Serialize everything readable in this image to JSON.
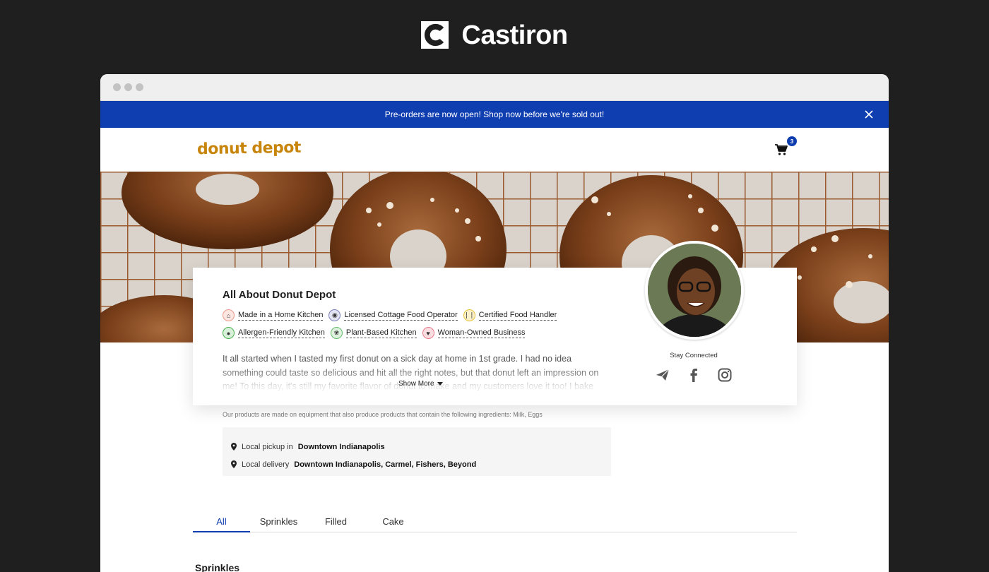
{
  "brand": {
    "name": "Castiron"
  },
  "announcement": {
    "text": "Pre-orders are now open! Shop now before we're sold out!"
  },
  "site": {
    "logo_text": "donut depot",
    "cart_count": "3"
  },
  "about": {
    "title": "All About Donut Depot",
    "badges_row1": [
      {
        "label": "Made in a Home Kitchen",
        "icon": "home-icon",
        "color": "#e89a8a"
      },
      {
        "label": "Licensed Cottage Food Operator",
        "icon": "shield-icon",
        "color": "#7a7fb8"
      },
      {
        "label": "Certified Food Handler",
        "icon": "utensils-icon",
        "color": "#e8c23a"
      }
    ],
    "badges_row2": [
      {
        "label": "Allergen-Friendly Kitchen",
        "icon": "allergen-icon",
        "color": "#4caf50"
      },
      {
        "label": "Plant-Based Kitchen",
        "icon": "sprout-icon",
        "color": "#66bb6a"
      },
      {
        "label": "Woman-Owned Business",
        "icon": "heart-icon",
        "color": "#e57c8c"
      }
    ],
    "story": "It all started when I tasted my first donut on a sick day at home in 1st grade. I had no idea something could taste so delicious and hit all the right notes, but that donut left an impression on me! To this day, it's still my favorite flavor of donut to make and my customers love it too! I bake",
    "show_more_label": "Show More",
    "stay_connected_label": "Stay Connected",
    "socials": [
      "telegram-icon",
      "facebook-icon",
      "instagram-icon"
    ]
  },
  "allergen_note": "Our products are made on equipment that also produce products that contain the following ingredients: Milk, Eggs",
  "fulfillment": {
    "pickup_prefix": "Local pickup in",
    "pickup_area": "Downtown Indianapolis",
    "delivery_prefix": "Local delivery",
    "delivery_area": "Downtown Indianapolis, Carmel, Fishers, Beyond"
  },
  "tabs": [
    {
      "label": "All",
      "active": true
    },
    {
      "label": "Sprinkles",
      "active": false
    },
    {
      "label": "Filled",
      "active": false
    },
    {
      "label": "Cake",
      "active": false
    }
  ],
  "section": {
    "title": "Sprinkles"
  },
  "colors": {
    "accent": "#0f3eb0",
    "background": "#1f1f1f",
    "logo": "#c8850c"
  }
}
